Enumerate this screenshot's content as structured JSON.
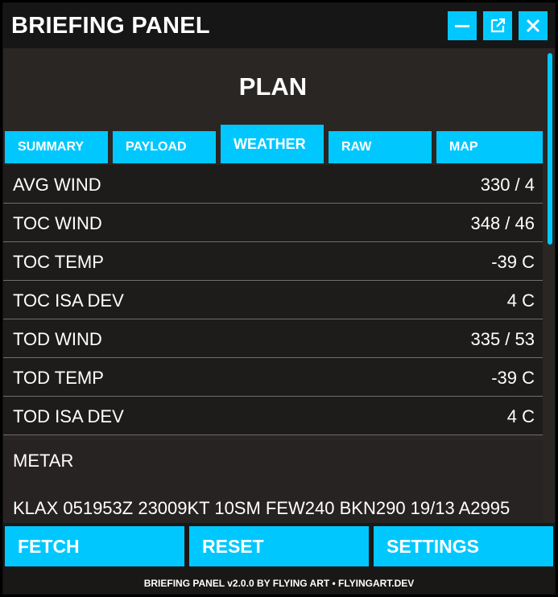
{
  "window": {
    "title": "BRIEFING PANEL",
    "accent_color": "#00c8ff",
    "controls": [
      {
        "name": "minimize",
        "icon": "minimize-icon"
      },
      {
        "name": "popout",
        "icon": "external-window-icon"
      },
      {
        "name": "close",
        "icon": "close-icon"
      }
    ]
  },
  "panel": {
    "heading": "PLAN",
    "tabs": [
      {
        "label": "SUMMARY",
        "active": false
      },
      {
        "label": "PAYLOAD",
        "active": false
      },
      {
        "label": "WEATHER",
        "active": true
      },
      {
        "label": "RAW",
        "active": false
      },
      {
        "label": "MAP",
        "active": false
      }
    ],
    "rows": [
      {
        "label": "AVG WIND",
        "value": "330 / 4"
      },
      {
        "label": "TOC WIND",
        "value": "348 / 46"
      },
      {
        "label": "TOC TEMP",
        "value": "-39 C"
      },
      {
        "label": "TOC ISA DEV",
        "value": "4 C"
      },
      {
        "label": "TOD WIND",
        "value": "335 / 53"
      },
      {
        "label": "TOD TEMP",
        "value": "-39 C"
      },
      {
        "label": "TOD ISA DEV",
        "value": "4 C"
      }
    ],
    "metar": {
      "label": "METAR",
      "text": "KLAX 051953Z 23009KT 10SM FEW240 BKN290 19/13 A2995"
    }
  },
  "actions": {
    "fetch": "FETCH",
    "reset": "RESET",
    "settings": "SETTINGS"
  },
  "footer": "BRIEFING PANEL v2.0.0 BY FLYING ART • FLYINGART.DEV"
}
